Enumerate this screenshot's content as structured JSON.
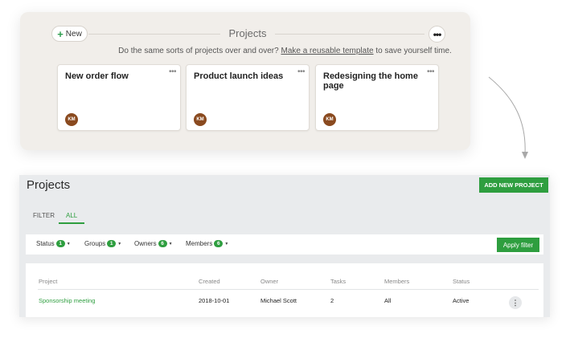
{
  "top": {
    "new_button_label": "New",
    "title": "Projects",
    "subtitle_before": "Do the same sorts of projects over and over? ",
    "subtitle_link": "Make a reusable template",
    "subtitle_after": " to save yourself time.",
    "cards": [
      {
        "title": "New order flow",
        "avatar": "KM"
      },
      {
        "title": "Product launch ideas",
        "avatar": "KM"
      },
      {
        "title": "Redesigning the home page",
        "avatar": "KM"
      }
    ]
  },
  "bottom": {
    "title": "Projects",
    "add_button_label": "ADD NEW PROJECT",
    "tabs": [
      "FILTER",
      "ALL"
    ],
    "filters": [
      {
        "label": "Status",
        "count": "1"
      },
      {
        "label": "Groups",
        "count": "1"
      },
      {
        "label": "Owners",
        "count": "6"
      },
      {
        "label": "Members",
        "count": "6"
      }
    ],
    "apply_filter_label": "Apply filter",
    "table": {
      "headers": [
        "Project",
        "Created",
        "Owner",
        "Tasks",
        "Members",
        "Status"
      ],
      "rows": [
        [
          "Sponsorship meeting",
          "2018-10-01",
          "Michael Scott",
          "2",
          "All",
          "Active"
        ]
      ]
    }
  },
  "colors": {
    "accent_green": "#2e9e3f",
    "avatar_brown": "#8a4a1f",
    "top_panel_bg": "#f1eeea",
    "bottom_panel_bg": "#e9ebed"
  }
}
